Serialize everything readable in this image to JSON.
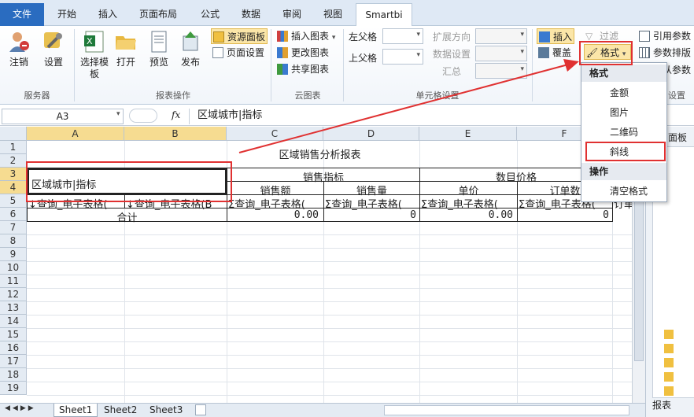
{
  "tabs": {
    "file": "文件",
    "items": [
      "开始",
      "插入",
      "页面布局",
      "公式",
      "数据",
      "审阅",
      "视图",
      "Smartbi"
    ],
    "active": "Smartbi"
  },
  "ribbon": {
    "server": {
      "logout": "注销",
      "settings": "设置",
      "group": "服务器"
    },
    "report": {
      "select_template": "选择模板",
      "open": "打开",
      "preview": "预览",
      "publish": "发布",
      "resource_panel": "资源面板",
      "page_setup": "页面设置",
      "group": "报表操作"
    },
    "cloud": {
      "insert_chart": "插入图表",
      "change_chart": "更改图表",
      "share_chart": "共享图表",
      "group": "云图表"
    },
    "cell": {
      "left_parent": "左父格",
      "up_parent": "上父格",
      "expand_direction": "扩展方向",
      "data_setting": "数据设置",
      "summary": "汇总",
      "group": "单元格设置"
    },
    "tools": {
      "insert": "插入",
      "overlay": "覆盖",
      "filter": "过滤",
      "format": "格式",
      "ref_param": "引用参数",
      "param_layout": "参数排版",
      "person_param": "从参数",
      "group": "设置"
    }
  },
  "formula_bar": {
    "namebox": "A3",
    "fx": "fx",
    "content": "区域城市|指标"
  },
  "sheet": {
    "columns": [
      "A",
      "B",
      "C",
      "D",
      "E",
      "F"
    ],
    "rows": [
      "1",
      "2",
      "3",
      "4",
      "5",
      "6",
      "7",
      "8",
      "9",
      "10",
      "11",
      "12",
      "13",
      "14",
      "15",
      "16",
      "17",
      "18",
      "19"
    ],
    "title": "区域销售分析报表",
    "diag_header": "区域城市|指标",
    "group_sales": "销售指标",
    "group_price": "数目价格",
    "h_amount": "销售额",
    "h_qty": "销售量",
    "h_unit_price": "单价",
    "h_order_count": "订单数",
    "r5_a": "↓查询_电子表格(",
    "r5_b": "↓查询_电子表格(B",
    "r5_c": "Σ查询_电子表格(",
    "r5_d": "Σ查询_电子表格(",
    "r5_e": "Σ查询_电子表格(",
    "r5_f": "Σ查询_电子表格(",
    "r5_g": "订单",
    "total_label": "合计",
    "total_c": "0.00",
    "total_d": "0",
    "total_e": "0.00",
    "total_f": "0"
  },
  "sheet_tabs": [
    "Sheet1",
    "Sheet2",
    "Sheet3"
  ],
  "right_pane": {
    "header": "面板",
    "footer": "报表"
  },
  "menu": {
    "section_format": "格式",
    "items": [
      "金额",
      "图片",
      "二维码",
      "斜线"
    ],
    "section_ops": "操作",
    "clear": "清空格式"
  },
  "colors": {
    "accent": "#2a6cc0",
    "annotation": "#e03131",
    "selection": "#f6dc91"
  }
}
